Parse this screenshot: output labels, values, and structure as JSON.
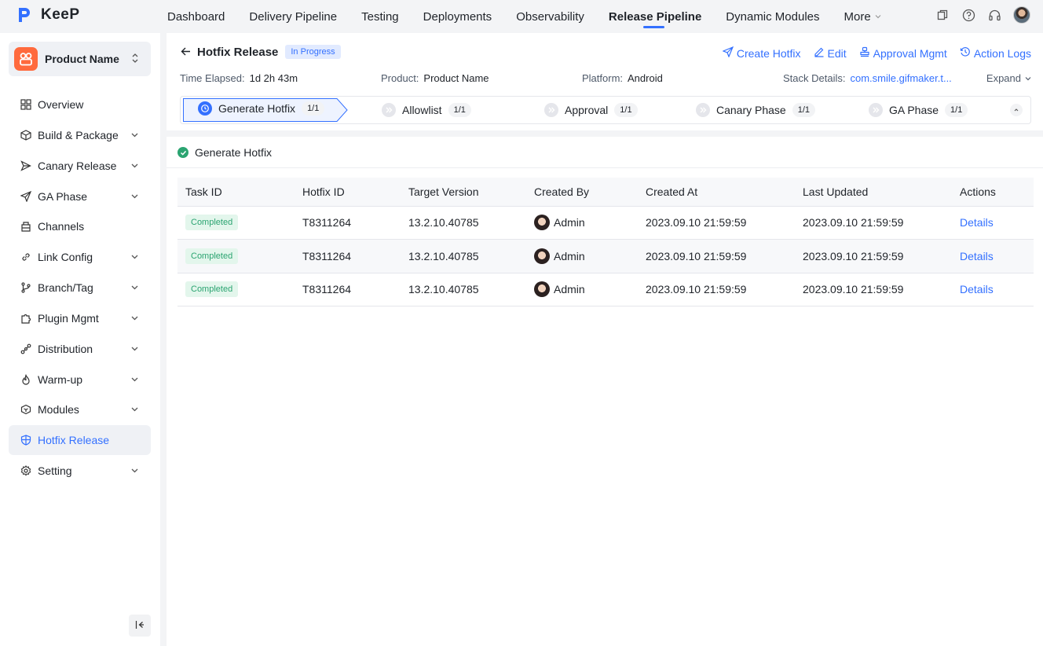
{
  "app": {
    "name": "KeeP",
    "brand_color": "#3370ff"
  },
  "nav": {
    "items": [
      "Dashboard",
      "Delivery Pipeline",
      "Testing",
      "Deployments",
      "Observability",
      "Release Pipeline",
      "Dynamic Modules"
    ],
    "active": "Release Pipeline",
    "more_label": "More"
  },
  "top_icons": [
    "copy-icon",
    "help-icon",
    "headset-icon",
    "user-avatar"
  ],
  "sidebar": {
    "product_name": "Product Name",
    "items": [
      {
        "label": "Overview",
        "icon": "grid-icon",
        "has_children": false
      },
      {
        "label": "Build & Package",
        "icon": "package-icon",
        "has_children": true
      },
      {
        "label": "Canary Release",
        "icon": "send-icon",
        "has_children": true
      },
      {
        "label": "GA Phase",
        "icon": "plane-icon",
        "has_children": true
      },
      {
        "label": "Channels",
        "icon": "store-icon",
        "has_children": false
      },
      {
        "label": "Link Config",
        "icon": "link-icon",
        "has_children": true
      },
      {
        "label": "Branch/Tag",
        "icon": "branch-icon",
        "has_children": true
      },
      {
        "label": "Plugin Mgmt",
        "icon": "puzzle-icon",
        "has_children": true
      },
      {
        "label": "Distribution",
        "icon": "distribution-icon",
        "has_children": true
      },
      {
        "label": "Warm-up",
        "icon": "flame-icon",
        "has_children": true
      },
      {
        "label": "Modules",
        "icon": "cube-icon",
        "has_children": true
      },
      {
        "label": "Hotfix Release",
        "icon": "shield-icon",
        "has_children": false,
        "active": true
      },
      {
        "label": "Setting",
        "icon": "gear-icon",
        "has_children": true
      }
    ]
  },
  "header": {
    "title": "Hotfix Release",
    "status": "In Progress",
    "actions": [
      {
        "label": "Create Hotfix",
        "icon": "send-icon"
      },
      {
        "label": "Edit",
        "icon": "edit-icon"
      },
      {
        "label": "Approval Mgmt",
        "icon": "stamp-icon"
      },
      {
        "label": "Action Logs",
        "icon": "history-icon"
      }
    ],
    "info": {
      "time_elapsed_label": "Time Elapsed:",
      "time_elapsed": "1d 2h 43m",
      "product_label": "Product:",
      "product": "Product Name",
      "platform_label": "Platform:",
      "platform": "Android",
      "stack_label": "Stack Details:",
      "stack": "com.smile.gifmaker.t...",
      "expand_label": "Expand"
    }
  },
  "steps": [
    {
      "label": "Generate Hotfix",
      "count": "1/1",
      "active": true
    },
    {
      "label": "Allowlist",
      "count": "1/1"
    },
    {
      "label": "Approval",
      "count": "1/1"
    },
    {
      "label": "Canary Phase",
      "count": "1/1"
    },
    {
      "label": "GA Phase",
      "count": "1/1"
    }
  ],
  "section": {
    "title": "Generate Hotfix"
  },
  "table": {
    "columns": [
      "Task ID",
      "Hotfix ID",
      "Target Version",
      "Created By",
      "Created At",
      "Last Updated",
      "Actions"
    ],
    "rows": [
      {
        "task": "Completed",
        "hotfix": "T8311264",
        "version": "13.2.10.40785",
        "by": "Admin",
        "created": "2023.09.10 21:59:59",
        "updated": "2023.09.10 21:59:59",
        "action": "Details"
      },
      {
        "task": "Completed",
        "hotfix": "T8311264",
        "version": "13.2.10.40785",
        "by": "Admin",
        "created": "2023.09.10 21:59:59",
        "updated": "2023.09.10 21:59:59",
        "action": "Details"
      },
      {
        "task": "Completed",
        "hotfix": "T8311264",
        "version": "13.2.10.40785",
        "by": "Admin",
        "created": "2023.09.10 21:59:59",
        "updated": "2023.09.10 21:59:59",
        "action": "Details"
      }
    ]
  }
}
